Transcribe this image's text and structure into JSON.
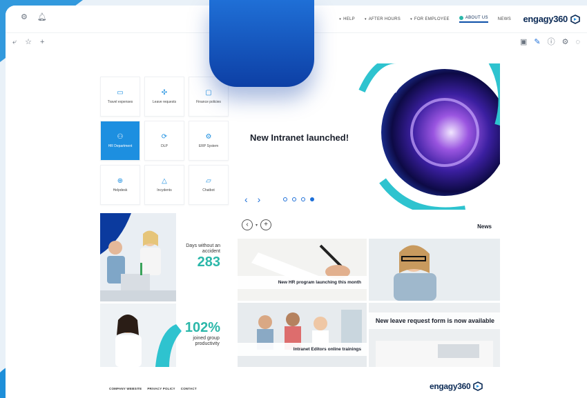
{
  "topbar": {
    "nav": [
      "NEWS",
      "ABOUT US",
      "FOR EMPLOYEE",
      "AFTER HOURS",
      "HELP"
    ],
    "active": "ABOUT US",
    "logo": "engagy360"
  },
  "tiles": [
    {
      "label": "Finance policies",
      "icon": "document-icon"
    },
    {
      "label": "Leave requests",
      "icon": "move-icon"
    },
    {
      "label": "Travel expenses",
      "icon": "briefcase-icon"
    },
    {
      "label": "ERP System",
      "icon": "gear-icon"
    },
    {
      "label": "DLP",
      "icon": "sync-icon"
    },
    {
      "label": "HR Department",
      "icon": "people-icon",
      "highlight": true
    },
    {
      "label": "Chatbot",
      "icon": "chat-icon"
    },
    {
      "label": "Incydents",
      "icon": "warning-icon"
    },
    {
      "label": "Helpdesk",
      "icon": "lifebuoy-icon"
    }
  ],
  "hero": {
    "title": "New Intranet launched!",
    "dots_total": 4,
    "dot_active": 4
  },
  "stats": {
    "days_label": "Days without an accident",
    "days_value": "283",
    "growth_value": "102%",
    "growth_label": "joined group productivity"
  },
  "news": {
    "title": "News",
    "items": [
      "New HR program launching this month",
      "New leave request form is now available",
      "Intranet Editors online trainings"
    ]
  },
  "footer": {
    "links": [
      "COMPANY WEBSITE",
      "PRIVACY POLICY",
      "CONTACT"
    ],
    "logo": "engagy360"
  },
  "colors": {
    "accent": "#1d8fe0",
    "teal": "#2ab7a9",
    "navy": "#0b2a55"
  }
}
